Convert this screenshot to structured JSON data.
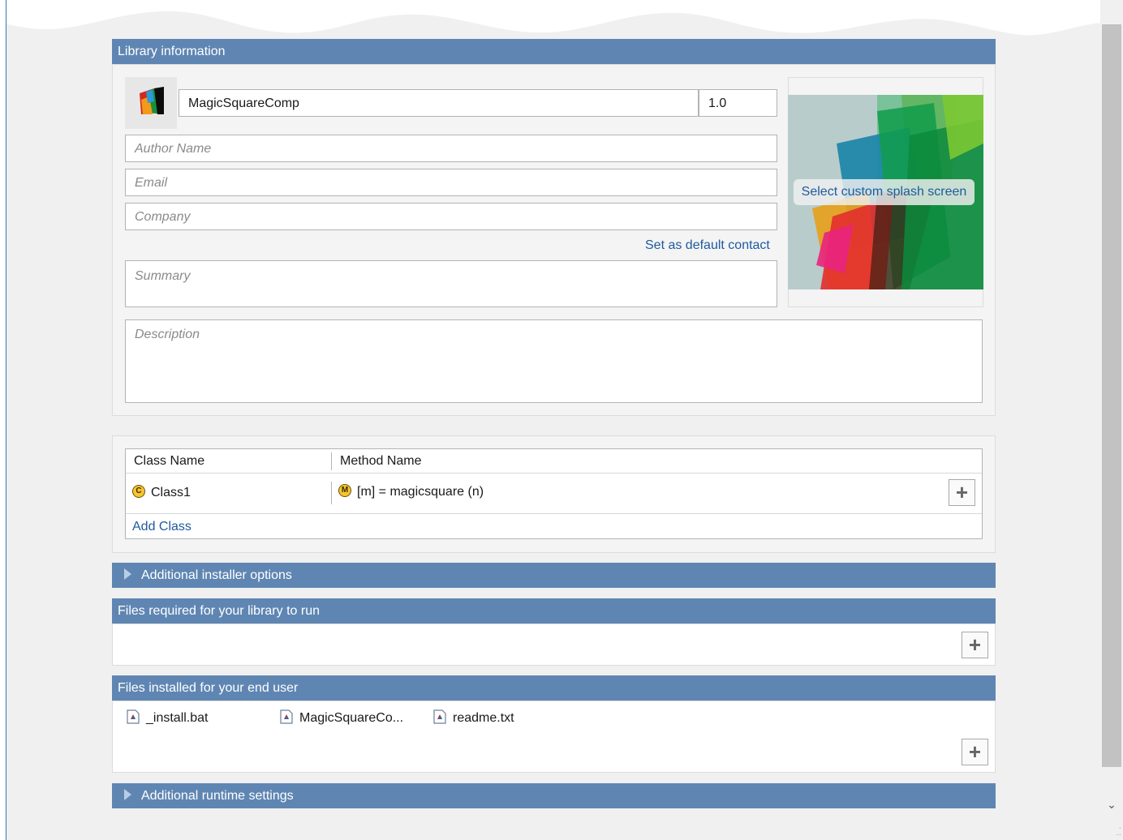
{
  "library_information": {
    "header": "Library information",
    "name_value": "MagicSquareComp",
    "version_value": "1.0",
    "author_placeholder": "Author Name",
    "email_placeholder": "Email",
    "company_placeholder": "Company",
    "set_default_contact": "Set as default contact",
    "summary_placeholder": "Summary",
    "description_placeholder": "Description",
    "splash_button": "Select custom splash screen"
  },
  "classes_table": {
    "columns": [
      "Class Name",
      "Method Name"
    ],
    "rows": [
      {
        "class_badge": "C",
        "class_name": "Class1",
        "method_badge": "M",
        "method": "[m] = magicsquare (n)"
      }
    ],
    "add_class": "Add Class"
  },
  "additional_installer_options": {
    "header": "Additional installer options"
  },
  "files_required": {
    "header": "Files required for your library to run"
  },
  "files_installed": {
    "header": "Files installed for your end user",
    "files": [
      "_install.bat",
      "MagicSquareCo...",
      "readme.txt"
    ]
  },
  "additional_runtime_settings": {
    "header": "Additional runtime settings"
  },
  "colors": {
    "section_header": "#5f86b3",
    "link": "#1f5a9c",
    "accent_border": "#2b7bc0"
  },
  "icons": {
    "app_icon": "matlab-app-icon",
    "class_icon": "class-c-icon",
    "method_icon": "method-m-icon",
    "file_icon": "matlab-file-icon",
    "add_icon": "plus-icon",
    "expand_icon": "triangle-right-icon",
    "scroll_down_icon": "chevron-down-icon"
  }
}
